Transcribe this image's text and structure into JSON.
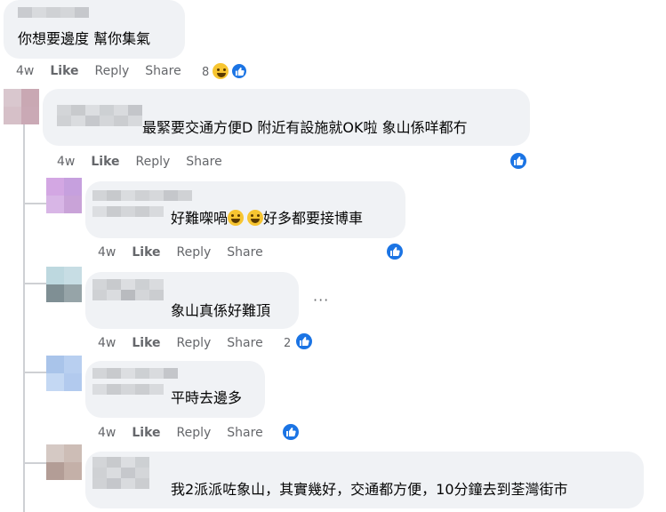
{
  "actions": {
    "time": "4w",
    "like": "Like",
    "reply": "Reply",
    "share": "Share"
  },
  "comments": [
    {
      "text": "你想要邊度 幫你集氣",
      "reaction_count": "8"
    },
    {
      "text": "最緊要交通方便D 附近有設施就OK啦 象山係咩都冇",
      "reaction_count": ""
    },
    {
      "text_before": "好難㗎喎",
      "text_after": "好多都要接博車",
      "reaction_count": ""
    },
    {
      "text": "象山真係好難頂",
      "reaction_count": "2",
      "more_label": "···"
    },
    {
      "text": "平時去邊多",
      "reaction_count": ""
    },
    {
      "text": "我2派派咗象山，其實幾好，交通都方便，10分鐘去到荃灣街市",
      "reaction_count": ""
    }
  ],
  "icons": {
    "like": "thumbs-up-icon",
    "haha": "haha-face-icon",
    "grin": "grin-face-icon",
    "more": "more-options-icon"
  },
  "colors": {
    "like_blue": "#1b74e4",
    "bubble": "#f0f2f5",
    "meta_text": "#65676b"
  }
}
